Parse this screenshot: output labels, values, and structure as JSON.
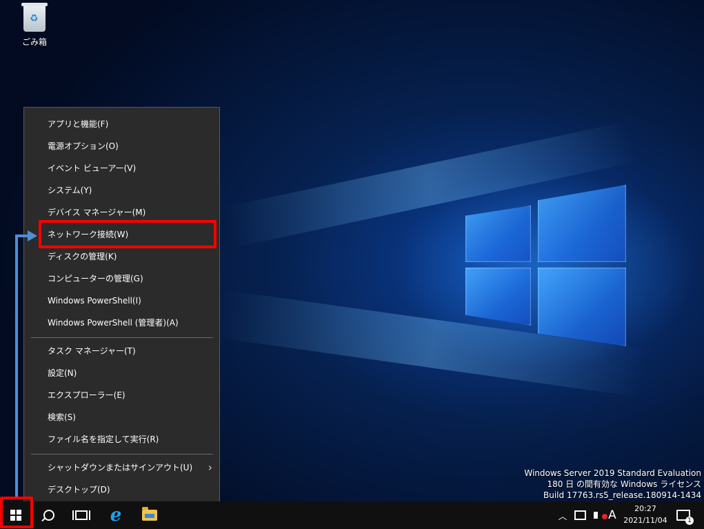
{
  "desktop": {
    "recycle_bin_label": "ごみ箱",
    "watermark": {
      "line1": "Windows Server 2019 Standard Evaluation",
      "line2": "180 日 の間有効な Windows ライセンス",
      "line3": "Build 17763.rs5_release.180914-1434"
    }
  },
  "context_menu": {
    "group1": [
      "アプリと機能(F)",
      "電源オプション(O)",
      "イベント ビューアー(V)",
      "システム(Y)",
      "デバイス マネージャー(M)",
      "ネットワーク接続(W)",
      "ディスクの管理(K)",
      "コンピューターの管理(G)",
      "Windows PowerShell(I)",
      "Windows PowerShell (管理者)(A)"
    ],
    "group2": [
      "タスク マネージャー(T)",
      "設定(N)",
      "エクスプローラー(E)",
      "検索(S)",
      "ファイル名を指定して実行(R)"
    ],
    "group3": [
      "シャットダウンまたはサインアウト(U)",
      "デスクトップ(D)"
    ],
    "submenu_chevron": "›",
    "highlighted_item": "ネットワーク接続(W)"
  },
  "taskbar": {
    "icons": [
      "windows-start-icon",
      "search-icon",
      "task-view-icon",
      "internet-explorer-icon",
      "file-explorer-icon"
    ],
    "ie_glyph": "e",
    "tray": {
      "chevron": "︿",
      "ime": "A",
      "time": "20:27",
      "date": "2021/11/04",
      "notification_count": "1"
    }
  },
  "colors": {
    "annotation_red": "#ff0000",
    "annotation_arrow": "#4f8fd4",
    "menu_bg": "#2b2b2b"
  }
}
